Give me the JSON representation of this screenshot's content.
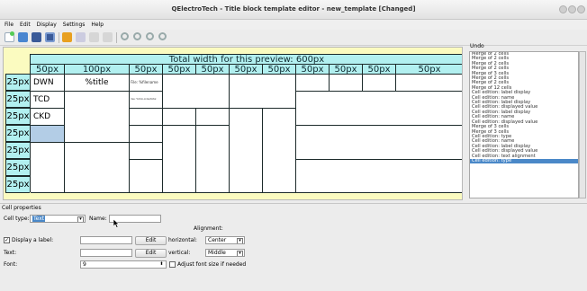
{
  "window": {
    "title": "QElectroTech - Title block template editor - new_template [Changed]"
  },
  "menu": [
    "File",
    "Edit",
    "Display",
    "Settings",
    "Help"
  ],
  "toolbar_icons": [
    "new-icon",
    "open-icon",
    "save-icon",
    "save-as-icon",
    "merge-cells-icon",
    "split-cells-icon",
    "add-column-icon",
    "add-row-icon",
    "zoom-in-icon",
    "zoom-out-icon",
    "zoom-fit-icon",
    "zoom-reset-icon"
  ],
  "preview": {
    "total_width_label": "Total width for this preview: 600px",
    "column_widths": [
      "50px",
      "100px",
      "50px",
      "50px",
      "50px",
      "50px",
      "50px",
      "50px",
      "50px",
      "50px",
      "50px"
    ],
    "row_heights": [
      "25px",
      "25px",
      "25px",
      "25px",
      "25px",
      "25px",
      "25px"
    ],
    "cells": {
      "dwn": "DWN",
      "title": "%title",
      "tcd": "TCD",
      "ckd": "CKD",
      "file": "File: %filename",
      "tiny_text": "Use: %folio-index/total"
    }
  },
  "undo": {
    "title": "Undo",
    "items": [
      "Merge of 2 cells",
      "Merge of 2 cells",
      "Merge of 2 cells",
      "Merge of 2 cells",
      "Merge of 3 cells",
      "Merge of 2 cells",
      "Merge of 2 cells",
      "Merge of 12 cells",
      "Cell edition: label display",
      "Cell edition: name",
      "Cell edition: label display",
      "Cell edition: displayed value",
      "Cell edition: label display",
      "Cell edition: name",
      "Cell edition: displayed value",
      "Merge of 3 cells",
      "Merge of 3 cells",
      "Cell edition: type",
      "Cell edition: name",
      "Cell edition: label display",
      "Cell edition: displayed value",
      "Cell edition: text alignment",
      "Cell edition: type"
    ]
  },
  "props": {
    "title": "Cell properties",
    "cell_type_label": "Cell type:",
    "cell_type_value": "Text",
    "name_label": "Name:",
    "name_value": "",
    "alignment_label": "Alignment:",
    "display_label": "Display a label:",
    "display_label_value": "",
    "text_label": "Text:",
    "text_value": "",
    "edit_label": "Edit",
    "horizontal_label": "horizontal:",
    "horizontal_value": "Center",
    "vertical_label": "vertical:",
    "vertical_value": "Middle",
    "font_label": "Font:",
    "font_value": "9",
    "adjust_label": "Adjust font size if needed"
  },
  "colors": {
    "header_bg": "#b2f0f0",
    "preview_bg": "#fbfbc0",
    "selected_cell": "#b3cde6",
    "selection": "#4a88c8"
  }
}
